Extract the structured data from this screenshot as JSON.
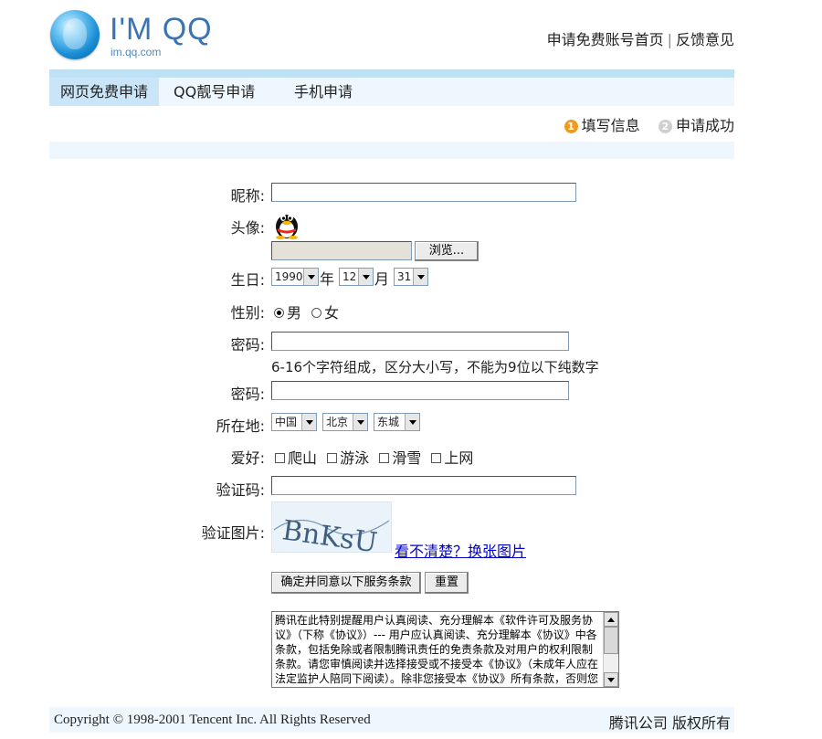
{
  "header": {
    "logo_text": "I'M QQ",
    "logo_sub": "im.qq.com",
    "links": [
      "申请免费账号首页",
      "反馈意见"
    ],
    "link_separator": "|"
  },
  "tabs": [
    {
      "label": "网页免费申请",
      "active": true
    },
    {
      "label": "QQ靓号申请",
      "active": false
    },
    {
      "label": "手机申请",
      "active": false
    }
  ],
  "steps": [
    {
      "num": "1",
      "label": "填写信息",
      "active": true
    },
    {
      "num": "2",
      "label": "申请成功",
      "active": false
    }
  ],
  "form": {
    "nickname_label": "昵称:",
    "nickname_value": "",
    "avatar_label": "头像:",
    "browse_label": "浏览...",
    "birthday_label": "生日:",
    "birth_year": "1990",
    "year_unit": "年",
    "birth_month": "12",
    "month_unit": "月",
    "birth_day": "31",
    "gender_label": "性别:",
    "gender_male": "男",
    "gender_female": "女",
    "gender_selected": "男",
    "password_label": "密码:",
    "password_hint": "6-16个字符组成，区分大小写，不能为9位以下纯数字",
    "password_confirm_label": "密码:",
    "location_label": "所在地:",
    "country": "中国",
    "province": "北京",
    "district": "东城",
    "hobby_label": "爱好:",
    "hobbies": [
      "爬山",
      "游泳",
      "滑雪",
      "上网"
    ],
    "captcha_label": "验证码:",
    "captcha_image_label": "验证图片:",
    "captcha_text": "BnKsU",
    "captcha_refresh": "看不清楚？换张图片",
    "submit_label": "确定并同意以下服务条款",
    "reset_label": "重置",
    "terms_text": "腾讯在此特别提醒用户认真阅读、充分理解本《软件许可及服务协议》（下称《协议》）--- 用户应认真阅读、充分理解本《协议》中各条款，包括免除或者限制腾讯责任的免责条款及对用户的权利限制条款。请您审慎阅读并选择接受或不接受本《协议》（未成年人应在法定监护人陪同下阅读）。除非您接受本《协议》所有条款，否则您无"
  },
  "footer": {
    "copyright": "Copyright © 1998-2001 Tencent Inc. All Rights Reserved",
    "rights": "腾讯公司 版权所有"
  },
  "colors": {
    "tab_bar": "#eef7fd",
    "tab_active": "#c9e5f7",
    "step_active": "#f29a1b",
    "link": "#0000cc"
  }
}
